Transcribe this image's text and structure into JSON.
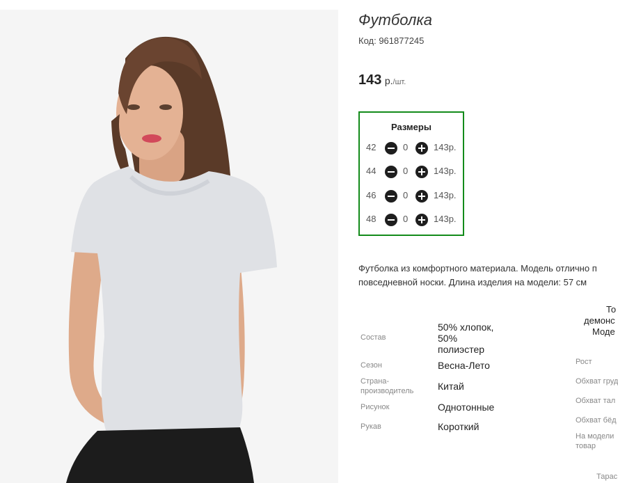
{
  "product": {
    "title": "Футболка",
    "code": "Код: 961877245",
    "price_value": "143",
    "price_unit_main": "р.",
    "price_unit_small": "/шт."
  },
  "sizes": {
    "title": "Размеры",
    "rows": [
      {
        "size": "42",
        "qty": "0",
        "price": "143р."
      },
      {
        "size": "44",
        "qty": "0",
        "price": "143р."
      },
      {
        "size": "46",
        "qty": "0",
        "price": "143р."
      },
      {
        "size": "48",
        "qty": "0",
        "price": "143р."
      }
    ]
  },
  "description": {
    "line1": "Футболка из комфортного материала. Модель отлично п",
    "line2": "повседневной носки. Длина изделия на модели: 57 см"
  },
  "attributes": [
    {
      "label": "Состав",
      "value_lines": [
        "50% хлопок,",
        "50%",
        "полиэстер"
      ]
    },
    {
      "label": "Сезон",
      "value_lines": [
        "Весна-Лето"
      ]
    },
    {
      "label_lines": [
        "Страна-",
        "производитель"
      ],
      "value_lines": [
        "Китай"
      ]
    },
    {
      "label": "Рисунок",
      "value_lines": [
        "Однотонные"
      ]
    },
    {
      "label": "Рукав",
      "value_lines": [
        "Короткий"
      ]
    }
  ],
  "model_params": {
    "heading_lines": [
      "То",
      "демонс",
      "Моде"
    ],
    "labels": [
      "Рост",
      "Обхват груд",
      "Обхват тал",
      "Обхват бёд",
      "На модели",
      "товар",
      "Тарас"
    ]
  },
  "icons": {
    "minus": "minus-circle-icon",
    "plus": "plus-circle-icon"
  },
  "colors": {
    "sizes_border": "#138b1a",
    "button": "#1e1e1e"
  }
}
